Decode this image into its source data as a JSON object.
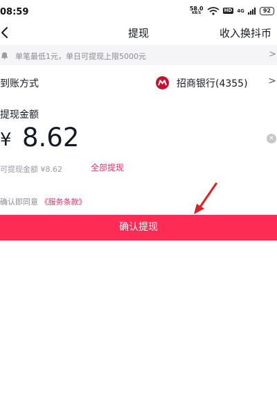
{
  "status_bar": {
    "time": "08:59",
    "net_speed_value": "58.0",
    "net_speed_unit": "KB/S",
    "hd_label": "HD",
    "signal_label": "4G",
    "battery": "92"
  },
  "nav": {
    "title": "提现",
    "right_label": "收入换抖币"
  },
  "notice": {
    "text": "单笔最低1元，单日可提现上限5000元"
  },
  "method": {
    "label": "到账方式",
    "bank_name": "招商银行(4355)",
    "bank_brand_color": "#c8102e"
  },
  "amount": {
    "label": "提现金额",
    "currency": "¥",
    "value": "8.62"
  },
  "available": {
    "text": "可提现金额 ¥8.62",
    "withdraw_all_label": "全部提现"
  },
  "agreement": {
    "prefix": "确认即同意",
    "terms_link": "《服务条款》"
  },
  "confirm_button": {
    "label": "确认提现"
  },
  "colors": {
    "accent": "#fe2c55",
    "link": "#e0336a",
    "annotation_arrow": "#e01f1f"
  }
}
